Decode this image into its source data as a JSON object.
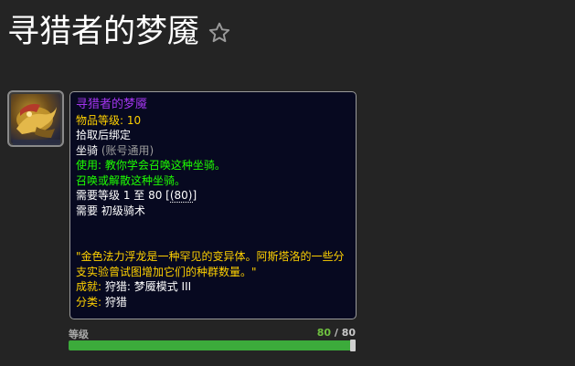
{
  "page": {
    "title": "寻猎者的梦魇",
    "favorite_icon": "star-outline-icon"
  },
  "item": {
    "icon": "golden-dragon-mount-icon",
    "name": "寻猎者的梦魇",
    "item_level_label": "物品等级:",
    "item_level": "10",
    "bind": "拾取后绑定",
    "type": "坐骑",
    "type_note": "(账号通用)",
    "use_label": "使用:",
    "use_text": "教你学会召唤这种坐骑。",
    "summon_text": "召唤或解散这种坐骑。",
    "req_level_prefix": "需要等级 1 至 80 [",
    "req_level_link": "(80)",
    "req_level_suffix": "]",
    "req_skill": "需要 初级骑术",
    "flavor_text": "\"金色法力浮龙是一种罕见的变异体。阿斯塔洛的一些分支实验曾试图增加它们的种群数量。\"",
    "achievement_label": "成就:",
    "achievement": "狩猎: 梦魇模式 III",
    "category_label": "分类:",
    "category": "狩猎"
  },
  "level_slider": {
    "label": "等级",
    "current": "80",
    "separator": " / ",
    "max": "80",
    "fill_fraction": 1.0
  },
  "colors": {
    "epic": "#a335ee",
    "gold": "#ffd100",
    "green": "#1eff00",
    "bar": "#3cab3b"
  }
}
